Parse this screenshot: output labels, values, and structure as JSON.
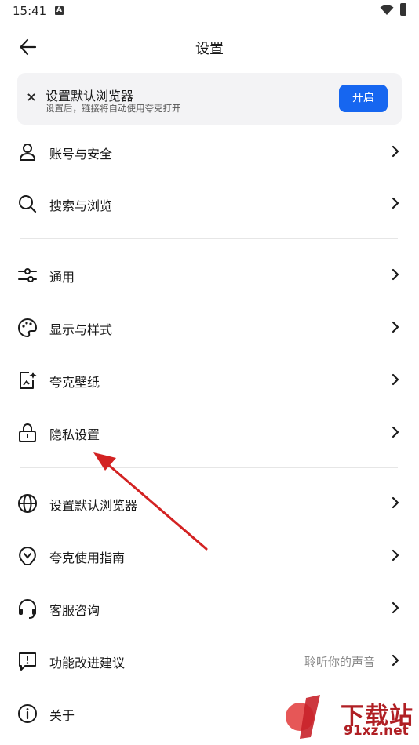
{
  "status_bar": {
    "time": "15:41",
    "notification_glyph": "A"
  },
  "header": {
    "title": "设置",
    "back_icon": "arrow-left-icon"
  },
  "banner": {
    "title": "设置默认浏览器",
    "subtitle": "设置后，链接将自动使用夸克打开",
    "button_label": "开启",
    "close_glyph": "×",
    "button_color": "#1666f0"
  },
  "groups": [
    {
      "items": [
        {
          "label": "账号与安全",
          "icon": "person-icon"
        },
        {
          "label": "搜索与浏览",
          "icon": "search-icon"
        }
      ]
    },
    {
      "items": [
        {
          "label": "通用",
          "icon": "sliders-icon"
        },
        {
          "label": "显示与样式",
          "icon": "palette-icon"
        },
        {
          "label": "夸克壁纸",
          "icon": "wallpaper-icon"
        },
        {
          "label": "隐私设置",
          "icon": "lock-icon"
        }
      ]
    },
    {
      "items": [
        {
          "label": "设置默认浏览器",
          "icon": "globe-icon"
        },
        {
          "label": "夸克使用指南",
          "icon": "bulb-icon"
        },
        {
          "label": "客服咨询",
          "icon": "headset-icon"
        },
        {
          "label": "功能改进建议",
          "icon": "feedback-icon",
          "value": "聆听你的声音"
        },
        {
          "label": "关于",
          "icon": "info-icon"
        }
      ]
    }
  ],
  "watermark": {
    "text_a": "下载站",
    "text_b": "91xz.net"
  },
  "annotation_arrow_color": "#d32222"
}
